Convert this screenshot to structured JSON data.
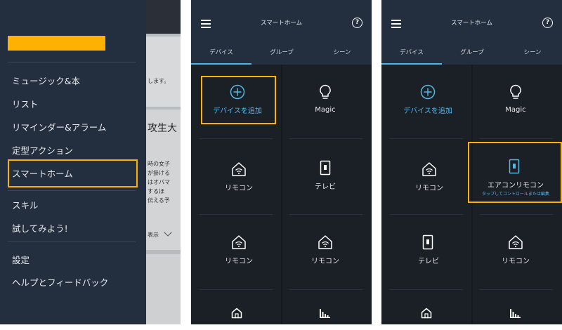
{
  "panel1": {
    "menu_items": [
      "ミュージック&本",
      "リスト",
      "リマインダー&アラーム",
      "定型アクション",
      "スマートホーム",
      "スキル",
      "試してみよう!",
      "設定",
      "ヘルプとフィードバック"
    ],
    "background_text": {
      "line1": "します。",
      "big": "攻生大",
      "lines": [
        "時の女子",
        "が掛ける",
        "はオバマ",
        "するほ",
        "伝える予"
      ],
      "show": "表示"
    }
  },
  "panel2": {
    "title": "スマートホーム",
    "tabs": [
      "デバイス",
      "グループ",
      "シーン"
    ],
    "tiles": [
      "デバイスを追加",
      "Magic",
      "リモコン",
      "テレビ",
      "リモコン",
      "リモコン"
    ]
  },
  "panel3": {
    "title": "スマートホーム",
    "tabs": [
      "デバイス",
      "グループ",
      "シーン"
    ],
    "tiles": [
      "デバイスを追加",
      "Magic",
      "リモコン",
      "エアコンリモコン",
      "テレビ",
      "リモコン"
    ],
    "tile_sub": "タップしてコントロールまたは編集"
  },
  "colors": {
    "highlight": "#ffb100",
    "accent": "#4fb6e6",
    "drawer": "#232f3e",
    "background": "#1b1f26"
  }
}
